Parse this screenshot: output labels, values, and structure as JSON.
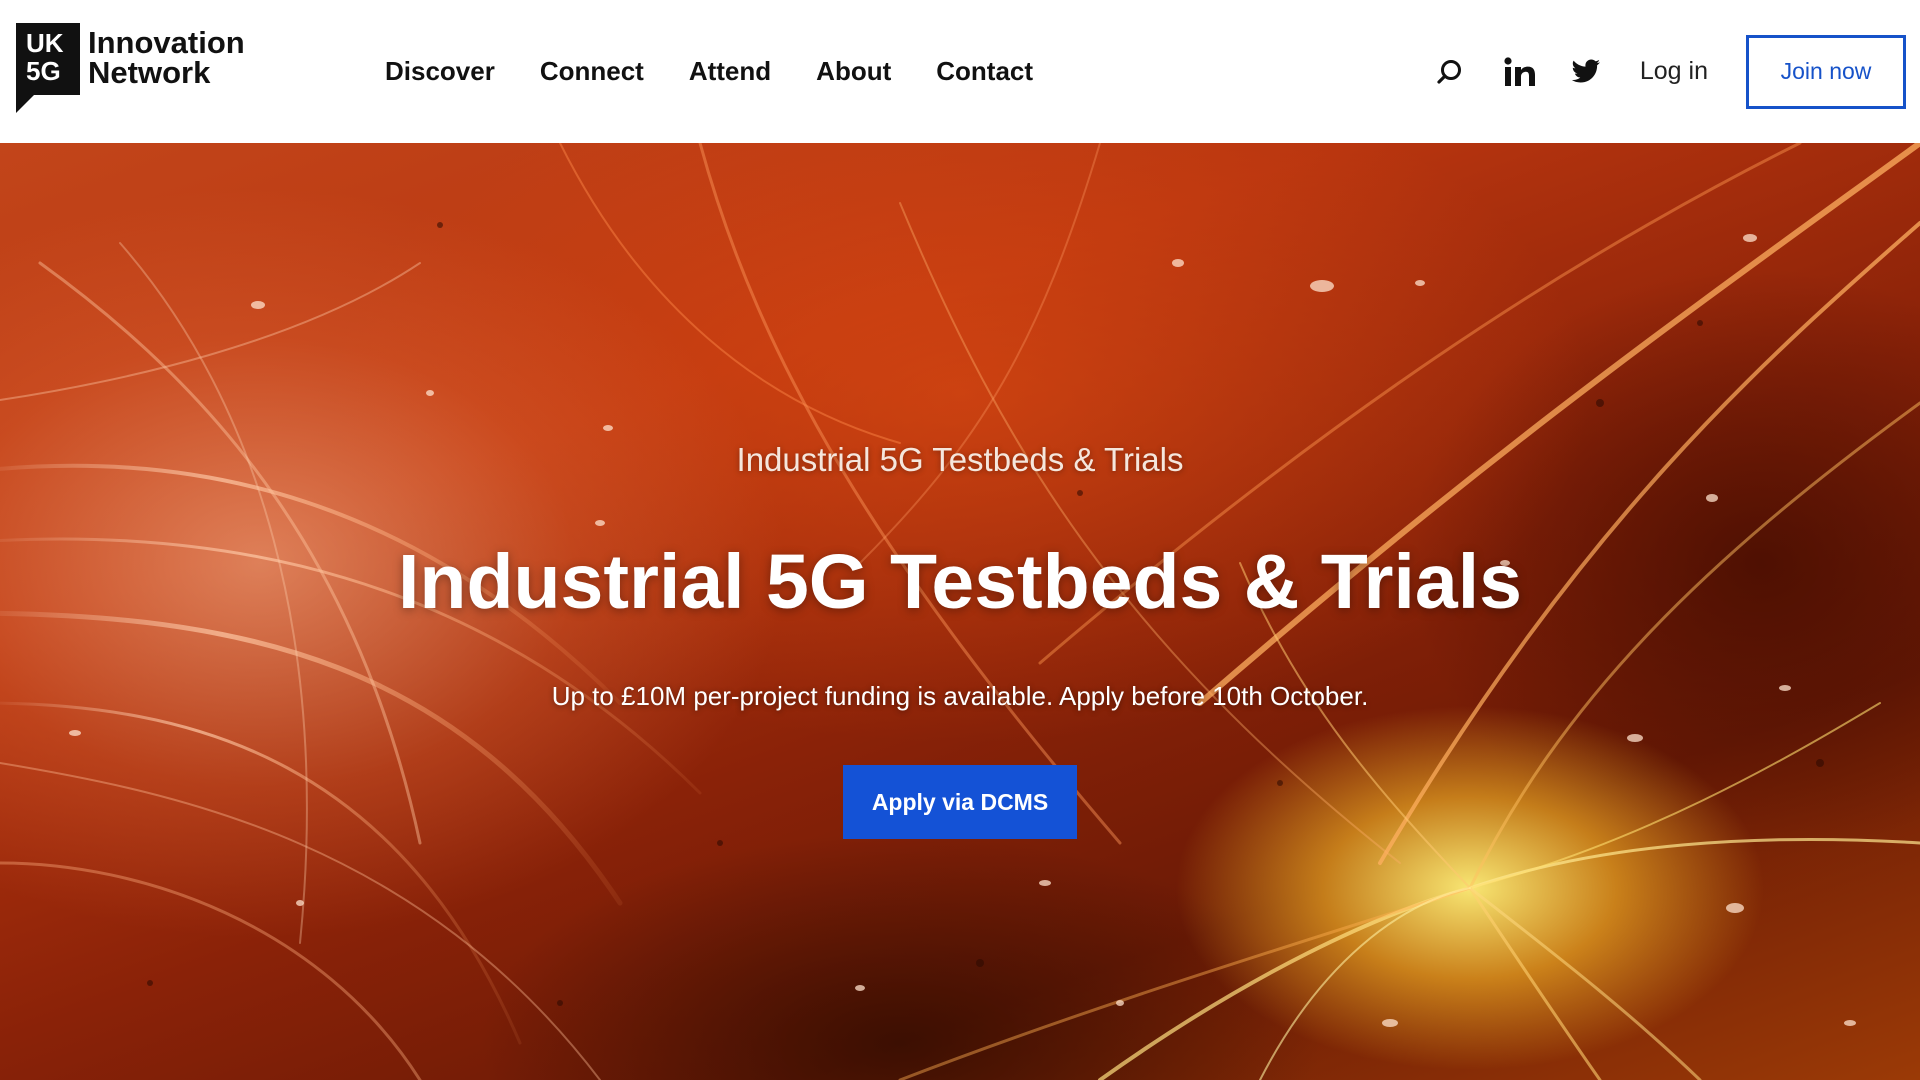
{
  "header": {
    "logo": {
      "mark_line1": "UK",
      "mark_line2": "5G",
      "text_line1": "Innovation",
      "text_line2": "Network"
    },
    "nav": [
      {
        "label": "Discover"
      },
      {
        "label": "Connect"
      },
      {
        "label": "Attend"
      },
      {
        "label": "About"
      },
      {
        "label": "Contact"
      }
    ],
    "icons": {
      "search": "search-icon",
      "linkedin": "linkedin-icon",
      "twitter": "twitter-icon"
    },
    "login_label": "Log in",
    "join_label": "Join now"
  },
  "hero": {
    "eyebrow": "Industrial 5G Testbeds & Trials",
    "title": "Industrial 5G Testbeds & Trials",
    "subtitle": "Up to £10M per-project funding is available. Apply before 10th October.",
    "cta_label": "Apply via DCMS"
  },
  "colors": {
    "brand_blue": "#1652c9",
    "cta_blue": "#1452d6",
    "text_dark": "#111111",
    "hero_orange": "#b8350f"
  }
}
